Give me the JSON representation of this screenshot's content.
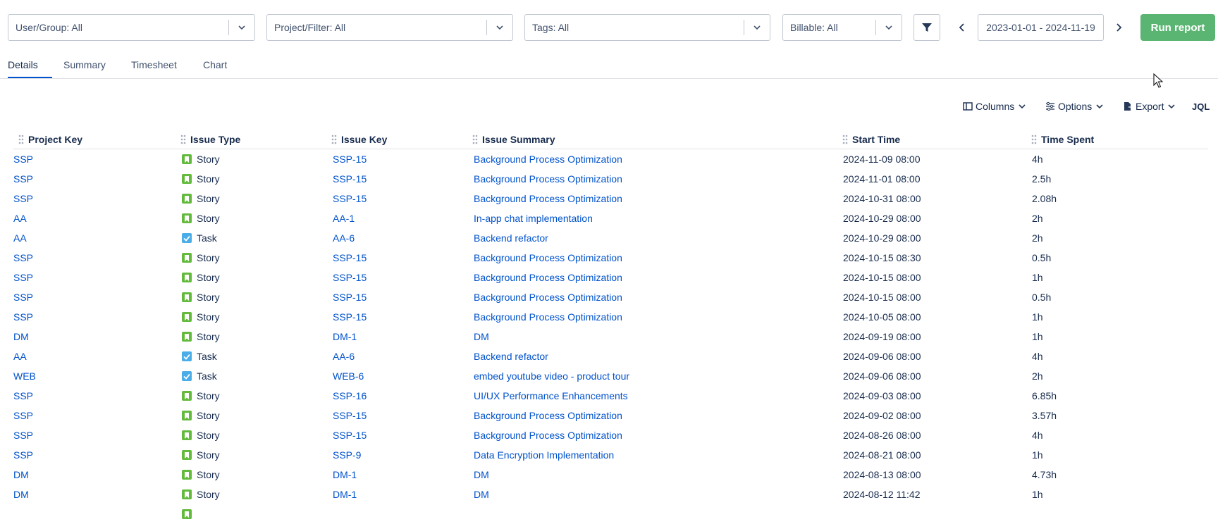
{
  "filters": {
    "user_group": "User/Group: All",
    "project_filter": "Project/Filter: All",
    "tags": "Tags: All",
    "billable": "Billable: All",
    "date_range": "2023-01-01 - 2024-11-19",
    "run_report": "Run report"
  },
  "tabs": [
    "Details",
    "Summary",
    "Timesheet",
    "Chart"
  ],
  "toolbar": {
    "columns": "Columns",
    "options": "Options",
    "export": "Export",
    "jql": "JQL"
  },
  "colors": {
    "story": "#63ba3c",
    "task": "#4bade8",
    "link": "#0052cc",
    "run": "#5bb572"
  },
  "table": {
    "headers": [
      "Project Key",
      "Issue Type",
      "Issue Key",
      "Issue Summary",
      "Start Time",
      "Time Spent"
    ],
    "rows": [
      [
        "SSP",
        "Story",
        "SSP-15",
        "Background Process Optimization",
        "2024-11-09 08:00",
        "4h"
      ],
      [
        "SSP",
        "Story",
        "SSP-15",
        "Background Process Optimization",
        "2024-11-01 08:00",
        "2.5h"
      ],
      [
        "SSP",
        "Story",
        "SSP-15",
        "Background Process Optimization",
        "2024-10-31 08:00",
        "2.08h"
      ],
      [
        "AA",
        "Story",
        "AA-1",
        "In-app chat implementation",
        "2024-10-29 08:00",
        "2h"
      ],
      [
        "AA",
        "Task",
        "AA-6",
        "Backend refactor",
        "2024-10-29 08:00",
        "2h"
      ],
      [
        "SSP",
        "Story",
        "SSP-15",
        "Background Process Optimization",
        "2024-10-15 08:30",
        "0.5h"
      ],
      [
        "SSP",
        "Story",
        "SSP-15",
        "Background Process Optimization",
        "2024-10-15 08:00",
        "1h"
      ],
      [
        "SSP",
        "Story",
        "SSP-15",
        "Background Process Optimization",
        "2024-10-15 08:00",
        "0.5h"
      ],
      [
        "SSP",
        "Story",
        "SSP-15",
        "Background Process Optimization",
        "2024-10-05 08:00",
        "1h"
      ],
      [
        "DM",
        "Story",
        "DM-1",
        "DM",
        "2024-09-19 08:00",
        "1h"
      ],
      [
        "AA",
        "Task",
        "AA-6",
        "Backend refactor",
        "2024-09-06 08:00",
        "4h"
      ],
      [
        "WEB",
        "Task",
        "WEB-6",
        "embed youtube video - product tour",
        "2024-09-06 08:00",
        "2h"
      ],
      [
        "SSP",
        "Story",
        "SSP-16",
        "UI/UX Performance Enhancements",
        "2024-09-03 08:00",
        "6.85h"
      ],
      [
        "SSP",
        "Story",
        "SSP-15",
        "Background Process Optimization",
        "2024-09-02 08:00",
        "3.57h"
      ],
      [
        "SSP",
        "Story",
        "SSP-15",
        "Background Process Optimization",
        "2024-08-26 08:00",
        "4h"
      ],
      [
        "SSP",
        "Story",
        "SSP-9",
        "Data Encryption Implementation",
        "2024-08-21 08:00",
        "1h"
      ],
      [
        "DM",
        "Story",
        "DM-1",
        "DM",
        "2024-08-13 08:00",
        "4.73h"
      ],
      [
        "DM",
        "Story",
        "DM-1",
        "DM",
        "2024-08-12 11:42",
        "1h"
      ]
    ]
  }
}
